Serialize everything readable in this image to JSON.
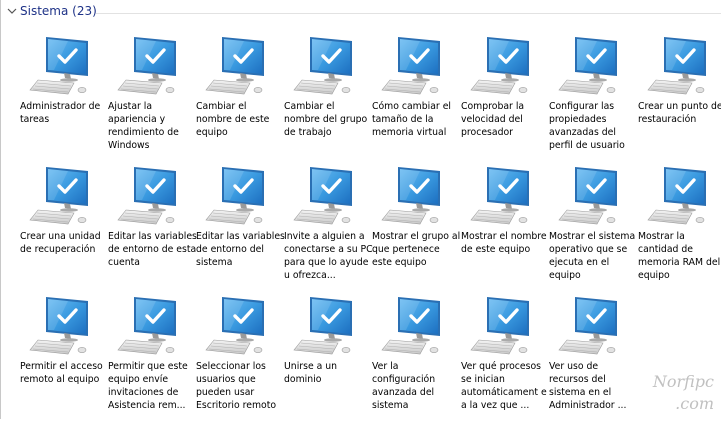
{
  "group": {
    "title": "Sistema (23)"
  },
  "items": [
    {
      "label": "Administrador de tareas"
    },
    {
      "label": "Ajustar la apariencia y rendimiento de Windows"
    },
    {
      "label": "Cambiar el nombre de este equipo"
    },
    {
      "label": "Cambiar el nombre del grupo de trabajo"
    },
    {
      "label": "Cómo cambiar el tamaño de la memoria virtual"
    },
    {
      "label": "Comprobar la velocidad del procesador"
    },
    {
      "label": "Configurar las propiedades avanzadas del perfil de usuario"
    },
    {
      "label": "Crear un punto de restauración"
    },
    {
      "label": "Crear una unidad de recuperación"
    },
    {
      "label": "Editar las variables de entorno de esta cuenta"
    },
    {
      "label": "Editar las variables de entorno del sistema"
    },
    {
      "label": "Invite a alguien a conectarse a su PC para que lo ayude u ofrezca..."
    },
    {
      "label": "Mostrar el grupo al que pertenece este equipo"
    },
    {
      "label": "Mostrar el nombre de este equipo"
    },
    {
      "label": "Mostrar el sistema operativo que se ejecuta en el equipo"
    },
    {
      "label": "Mostrar la cantidad de memoria RAM del equipo"
    },
    {
      "label": "Permitir el acceso remoto al equipo"
    },
    {
      "label": "Permitir que este equipo envíe invitaciones de Asistencia rem..."
    },
    {
      "label": "Seleccionar los usuarios que pueden usar Escritorio remoto"
    },
    {
      "label": "Unirse a un dominio"
    },
    {
      "label": "Ver la configuración avanzada del sistema"
    },
    {
      "label": "Ver qué procesos se inician automáticament e a la vez que ..."
    },
    {
      "label": "Ver uso de recursos del sistema en el Administrador ..."
    }
  ],
  "icons": {
    "item": "computer-checkmark-icon",
    "chevron": "chevron-down-icon"
  },
  "colors": {
    "screen": "#3a9ae0",
    "screen_dark": "#1d6fc0",
    "check": "#ffffff",
    "header_text": "#1e3287"
  },
  "watermark": {
    "line1": "Norfipc",
    "line2": ".com"
  }
}
